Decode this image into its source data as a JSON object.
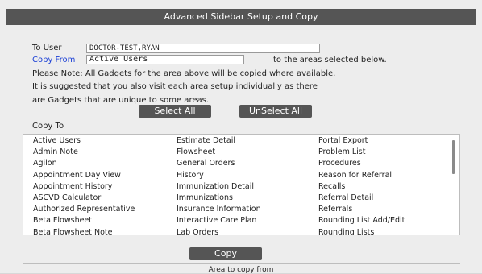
{
  "window": {
    "title": "Advanced Sidebar Setup and Copy"
  },
  "form": {
    "to_user_label": "To User",
    "to_user_value": "DOCTOR-TEST,RYAN",
    "copy_from_label": "Copy From",
    "copy_from_value": "Active Users",
    "areas_suffix": "to the areas selected below.",
    "note_line1": "Please Note: All Gadgets for the area above will be copied where available.",
    "note_line2": "It is suggested that you also visit each area setup individually as there",
    "note_line3": "are Gadgets that are unique to some areas."
  },
  "buttons": {
    "select_all": "Select All",
    "unselect_all": "UnSelect All",
    "copy": "Copy"
  },
  "copy_to": {
    "label": "Copy To",
    "columns": [
      [
        "Active Users",
        "Admin Note",
        "Agilon",
        "Appointment Day View",
        "Appointment History",
        "ASCVD Calculator",
        "Authorized Representative",
        "Beta Flowsheet",
        "Beta Flowsheet Note"
      ],
      [
        "Estimate Detail",
        "Flowsheet",
        "General Orders",
        "History",
        "Immunization Detail",
        "Immunizations",
        "Insurance Information",
        "Interactive Care Plan",
        "Lab Orders"
      ],
      [
        "Portal Export",
        "Problem List",
        "Procedures",
        "Reason for Referral",
        "Recalls",
        "Referral Detail",
        "Referrals",
        "Rounding List Add/Edit",
        "Rounding Lists"
      ]
    ]
  },
  "footer": {
    "text": "Area to copy from"
  },
  "colors": {
    "title_bar": "#555555",
    "button": "#555555",
    "link_blue": "#1a3fd6",
    "background": "#ededed"
  }
}
